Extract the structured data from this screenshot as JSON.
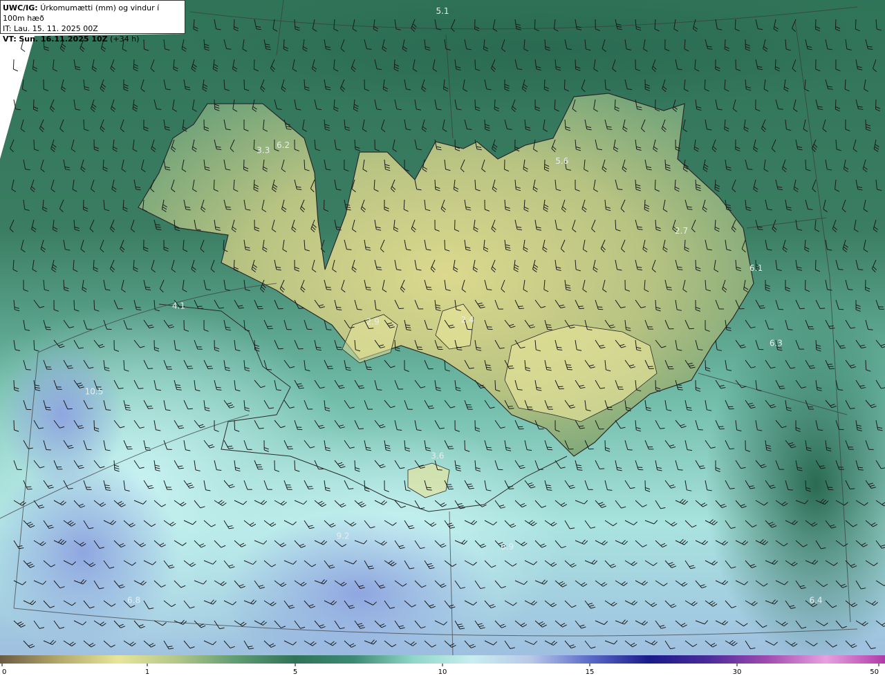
{
  "header": {
    "line1_bold": "UWC/IG:",
    "line1_text": "Úrkomumætti (mm) og vindur í 100m hæð",
    "line2": "IT: Lau. 15. 11. 2025 00Z",
    "line3_bold": "VT:",
    "line3_text": "Sun. 16.11.2025 10Z",
    "line3_extra": "(+34 h)"
  },
  "map_values": [
    {
      "label": "5.1",
      "lon": -19.0,
      "lat": 67.6
    },
    {
      "label": "6.2",
      "lon": -22.2,
      "lat": 66.35
    },
    {
      "label": "3.3",
      "lon": -22.6,
      "lat": 66.3
    },
    {
      "label": "5.6",
      "lon": -16.6,
      "lat": 66.2
    },
    {
      "label": "2.7",
      "lon": -14.2,
      "lat": 65.55
    },
    {
      "label": "6.1",
      "lon": -12.7,
      "lat": 65.2
    },
    {
      "label": "4.1",
      "lon": -24.3,
      "lat": 64.85
    },
    {
      "label": "2.9",
      "lon": -20.4,
      "lat": 64.7
    },
    {
      "label": "2.4",
      "lon": -18.5,
      "lat": 64.72
    },
    {
      "label": "6.3",
      "lon": -12.3,
      "lat": 64.5
    },
    {
      "label": "10.5",
      "lon": -26.0,
      "lat": 64.05
    },
    {
      "label": "3.6",
      "lon": -19.1,
      "lat": 63.45
    },
    {
      "label": "9.2",
      "lon": -21.0,
      "lat": 62.7
    },
    {
      "label": "6.9",
      "lon": -17.7,
      "lat": 62.6
    },
    {
      "label": "6.4",
      "lon": -11.5,
      "lat": 62.1
    },
    {
      "label": "6.8",
      "lon": -25.2,
      "lat": 62.1
    }
  ],
  "colorbar": {
    "ticks": [
      "0",
      "1",
      "5",
      "10",
      "15",
      "30",
      "50"
    ],
    "colors": [
      "#6b5a43",
      "#b3a86a",
      "#e8e59a",
      "#b2c789",
      "#5f9c72",
      "#2f7358",
      "#3c8a73",
      "#8fd6c8",
      "#c8eef0",
      "#b8c8e8",
      "#5a6ac8",
      "#1a1a8a",
      "#4a2a9a",
      "#a04ab0",
      "#e8a0e0",
      "#b03aa8"
    ]
  },
  "wind_barbs": "wind barbs in knots"
}
